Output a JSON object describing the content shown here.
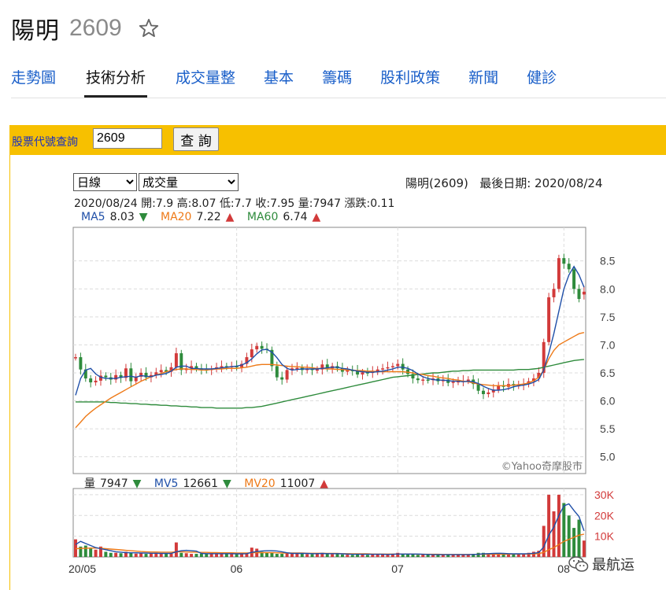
{
  "header": {
    "name": "陽明",
    "code": "2609"
  },
  "tabs": [
    "走勢圖",
    "技術分析",
    "成交量整",
    "基本",
    "籌碼",
    "股利政策",
    "新聞",
    "健診"
  ],
  "active_tab": 1,
  "query": {
    "label": "股票代號查詢",
    "value": "2609",
    "button": "查 詢"
  },
  "controls": {
    "period": "日線",
    "indicator": "成交量"
  },
  "info": {
    "title": "陽明(2609)",
    "last_date_label": "最後日期:",
    "last_date": "2020/08/24"
  },
  "ohlc": {
    "date": "2020/08/24",
    "open_label": "開:",
    "open": "7.9",
    "high_label": "高:",
    "high": "8.07",
    "low_label": "低:",
    "low": "7.7",
    "close_label": "收:",
    "close": "7.95",
    "volume_label": "量:",
    "volume": "7947",
    "change_label": "漲跌:",
    "change": "0.11"
  },
  "ma": [
    {
      "label": "MA5",
      "value": "8.03",
      "dir": "down",
      "color": "#1f4fa8"
    },
    {
      "label": "MA20",
      "value": "7.22",
      "dir": "up",
      "color": "#ee7a18"
    },
    {
      "label": "MA60",
      "value": "6.74",
      "dir": "up",
      "color": "#2e8b3c"
    }
  ],
  "volume_legend": [
    {
      "label": "量",
      "value": "7947",
      "dir": "down",
      "color": "#222222"
    },
    {
      "label": "MV5",
      "value": "12661",
      "dir": "down",
      "color": "#1f4fa8"
    },
    {
      "label": "MV20",
      "value": "11007",
      "dir": "up",
      "color": "#ee7a18"
    }
  ],
  "watermark": "©Yahoo奇摩股市",
  "logo_text": "最航运",
  "colors": {
    "up": "#d23a3a",
    "down": "#2e8b3c",
    "ma5": "#1f4fa8",
    "ma20": "#ee7a18",
    "ma60": "#2e8b3c",
    "accent": "#f7c000",
    "link": "#1a5fc9"
  },
  "chart_data": {
    "type": "candlestick",
    "y_ticks": [
      "8.5",
      "8.0",
      "7.5",
      "7.0",
      "6.5",
      "6.0",
      "5.5",
      "5.0"
    ],
    "ylim": [
      4.7,
      9.1
    ],
    "vol_ticks": [
      "30K",
      "20K",
      "10K"
    ],
    "vol_max": 33000,
    "x_labels": [
      "20/05",
      "06",
      "07",
      "08"
    ],
    "x_label_index": [
      0,
      32,
      64,
      97
    ],
    "closes": [
      6.78,
      6.56,
      6.4,
      6.33,
      6.36,
      6.45,
      6.42,
      6.38,
      6.46,
      6.41,
      6.58,
      6.35,
      6.43,
      6.5,
      6.42,
      6.46,
      6.51,
      6.55,
      6.52,
      6.6,
      6.85,
      6.55,
      6.58,
      6.62,
      6.58,
      6.56,
      6.55,
      6.57,
      6.6,
      6.62,
      6.61,
      6.62,
      6.6,
      6.66,
      6.78,
      6.92,
      6.98,
      6.93,
      6.91,
      6.62,
      6.42,
      6.38,
      6.55,
      6.58,
      6.59,
      6.55,
      6.57,
      6.55,
      6.56,
      6.65,
      6.58,
      6.62,
      6.58,
      6.52,
      6.55,
      6.54,
      6.47,
      6.51,
      6.5,
      6.52,
      6.56,
      6.58,
      6.6,
      6.62,
      6.66,
      6.56,
      6.48,
      6.4,
      6.37,
      6.38,
      6.37,
      6.4,
      6.35,
      6.38,
      6.32,
      6.34,
      6.35,
      6.36,
      6.38,
      6.3,
      6.18,
      6.12,
      6.15,
      6.2,
      6.28,
      6.25,
      6.3,
      6.27,
      6.28,
      6.3,
      6.35,
      6.4,
      6.5,
      7.05,
      7.85,
      8.0,
      8.55,
      8.45,
      8.35,
      8.0,
      7.82,
      7.95
    ],
    "volumes": [
      8.5,
      5.0,
      5.5,
      4.0,
      3.5,
      5.0,
      2.5,
      2.0,
      2.0,
      1.8,
      2.5,
      2.0,
      1.6,
      1.8,
      1.5,
      1.8,
      2.0,
      1.5,
      1.8,
      1.6,
      7.0,
      2.0,
      1.8,
      1.5,
      1.5,
      1.6,
      1.4,
      1.8,
      1.5,
      1.6,
      1.5,
      1.6,
      1.3,
      1.5,
      2.0,
      4.5,
      4.0,
      2.5,
      2.0,
      2.2,
      1.5,
      1.5,
      1.8,
      1.5,
      2.0,
      1.6,
      1.4,
      1.3,
      1.5,
      2.0,
      1.4,
      1.3,
      1.5,
      1.2,
      1.1,
      1.0,
      1.5,
      1.2,
      1.0,
      1.5,
      1.3,
      1.2,
      1.0,
      1.4,
      2.0,
      1.5,
      1.3,
      1.2,
      1.0,
      1.2,
      1.1,
      1.0,
      1.2,
      1.0,
      1.1,
      1.0,
      1.0,
      1.2,
      1.0,
      1.5,
      2.0,
      2.0,
      1.8,
      1.5,
      1.5,
      1.3,
      1.5,
      1.4,
      1.5,
      1.6,
      2.0,
      2.5,
      3.0,
      15.0,
      30.0,
      22.0,
      30.0,
      26.0,
      20.0,
      14.0,
      18.0,
      7.9
    ],
    "ma5": [
      6.1,
      6.4,
      6.55,
      6.58,
      6.48,
      6.42,
      6.4,
      6.4,
      6.4,
      6.42,
      6.43,
      6.44,
      6.42,
      6.45,
      6.44,
      6.43,
      6.46,
      6.47,
      6.49,
      6.53,
      6.6,
      6.62,
      6.62,
      6.58,
      6.58,
      6.57,
      6.57,
      6.57,
      6.58,
      6.59,
      6.6,
      6.61,
      6.62,
      6.64,
      6.68,
      6.75,
      6.84,
      6.91,
      6.92,
      6.87,
      6.77,
      6.65,
      6.58,
      6.55,
      6.56,
      6.57,
      6.57,
      6.57,
      6.57,
      6.58,
      6.59,
      6.6,
      6.6,
      6.58,
      6.57,
      6.55,
      6.53,
      6.52,
      6.51,
      6.51,
      6.52,
      6.53,
      6.55,
      6.57,
      6.6,
      6.6,
      6.58,
      6.54,
      6.48,
      6.43,
      6.4,
      6.38,
      6.37,
      6.37,
      6.36,
      6.35,
      6.35,
      6.34,
      6.35,
      6.34,
      6.31,
      6.26,
      6.22,
      6.19,
      6.19,
      6.2,
      6.22,
      6.25,
      6.27,
      6.28,
      6.3,
      6.33,
      6.38,
      6.55,
      6.85,
      7.2,
      7.6,
      8.0,
      8.25,
      8.4,
      8.25,
      8.03
    ],
    "ma20": [
      5.52,
      5.62,
      5.72,
      5.8,
      5.87,
      5.93,
      5.99,
      6.05,
      6.1,
      6.15,
      6.2,
      6.25,
      6.3,
      6.35,
      6.39,
      6.43,
      6.46,
      6.49,
      6.52,
      6.54,
      6.56,
      6.57,
      6.57,
      6.56,
      6.56,
      6.55,
      6.55,
      6.56,
      6.57,
      6.57,
      6.58,
      6.58,
      6.58,
      6.59,
      6.6,
      6.62,
      6.64,
      6.65,
      6.65,
      6.65,
      6.64,
      6.63,
      6.62,
      6.61,
      6.61,
      6.6,
      6.6,
      6.59,
      6.58,
      6.58,
      6.57,
      6.57,
      6.56,
      6.56,
      6.55,
      6.55,
      6.54,
      6.54,
      6.53,
      6.53,
      6.52,
      6.52,
      6.52,
      6.52,
      6.52,
      6.52,
      6.51,
      6.5,
      6.48,
      6.47,
      6.45,
      6.44,
      6.42,
      6.41,
      6.4,
      6.38,
      6.37,
      6.35,
      6.34,
      6.32,
      6.3,
      6.29,
      6.28,
      6.27,
      6.27,
      6.27,
      6.27,
      6.28,
      6.29,
      6.3,
      6.32,
      6.36,
      6.42,
      6.55,
      6.75,
      6.9,
      7.0,
      7.05,
      7.1,
      7.15,
      7.2,
      7.22
    ],
    "ma60": [
      5.98,
      5.98,
      5.98,
      5.98,
      5.98,
      5.98,
      5.98,
      5.97,
      5.97,
      5.96,
      5.96,
      5.95,
      5.95,
      5.94,
      5.94,
      5.93,
      5.93,
      5.92,
      5.92,
      5.91,
      5.91,
      5.9,
      5.9,
      5.89,
      5.89,
      5.88,
      5.88,
      5.88,
      5.87,
      5.87,
      5.87,
      5.87,
      5.87,
      5.87,
      5.88,
      5.88,
      5.89,
      5.9,
      5.92,
      5.94,
      5.96,
      5.98,
      6.0,
      6.02,
      6.04,
      6.06,
      6.08,
      6.1,
      6.12,
      6.14,
      6.16,
      6.18,
      6.2,
      6.22,
      6.24,
      6.26,
      6.28,
      6.3,
      6.32,
      6.34,
      6.36,
      6.38,
      6.4,
      6.42,
      6.43,
      6.44,
      6.45,
      6.46,
      6.47,
      6.48,
      6.49,
      6.5,
      6.5,
      6.51,
      6.52,
      6.53,
      6.53,
      6.54,
      6.54,
      6.55,
      6.55,
      6.55,
      6.55,
      6.55,
      6.55,
      6.55,
      6.55,
      6.55,
      6.56,
      6.56,
      6.56,
      6.57,
      6.58,
      6.6,
      6.62,
      6.64,
      6.66,
      6.68,
      6.7,
      6.72,
      6.73,
      6.74
    ],
    "mv5": [
      6.0,
      7.5,
      6.5,
      5.5,
      4.5,
      4.0,
      3.5,
      3.0,
      2.5,
      2.3,
      2.1,
      2.0,
      2.0,
      1.9,
      1.9,
      1.8,
      1.8,
      1.7,
      1.7,
      1.7,
      2.5,
      3.0,
      3.2,
      3.0,
      2.8,
      1.7,
      1.6,
      1.6,
      1.6,
      1.6,
      1.6,
      1.6,
      1.5,
      1.5,
      1.6,
      2.2,
      2.6,
      2.9,
      3.0,
      3.0,
      2.9,
      2.5,
      2.0,
      1.7,
      1.7,
      1.7,
      1.7,
      1.6,
      1.6,
      1.7,
      1.6,
      1.6,
      1.6,
      1.5,
      1.4,
      1.3,
      1.3,
      1.3,
      1.3,
      1.3,
      1.3,
      1.3,
      1.2,
      1.3,
      1.4,
      1.4,
      1.4,
      1.4,
      1.4,
      1.3,
      1.2,
      1.1,
      1.1,
      1.1,
      1.1,
      1.1,
      1.1,
      1.1,
      1.1,
      1.2,
      1.3,
      1.5,
      1.6,
      1.7,
      1.8,
      1.7,
      1.6,
      1.5,
      1.5,
      1.5,
      1.6,
      1.8,
      2.1,
      4.8,
      10.5,
      14.4,
      20.0,
      24.6,
      25.6,
      22.4,
      19.5,
      12.6
    ],
    "mv20": [
      4.0,
      4.1,
      4.2,
      4.3,
      4.3,
      4.2,
      4.0,
      3.8,
      3.6,
      3.4,
      3.2,
      3.0,
      2.8,
      2.6,
      2.5,
      2.4,
      2.4,
      2.3,
      2.3,
      2.3,
      2.5,
      2.5,
      2.4,
      2.3,
      2.3,
      2.2,
      2.2,
      2.1,
      2.1,
      2.0,
      2.0,
      2.0,
      1.9,
      1.9,
      1.9,
      2.0,
      2.1,
      2.1,
      2.1,
      2.1,
      2.0,
      1.9,
      1.9,
      1.9,
      1.9,
      1.9,
      1.8,
      1.8,
      1.8,
      1.8,
      1.7,
      1.7,
      1.7,
      1.6,
      1.6,
      1.5,
      1.5,
      1.5,
      1.5,
      1.4,
      1.4,
      1.4,
      1.4,
      1.4,
      1.4,
      1.4,
      1.4,
      1.4,
      1.3,
      1.3,
      1.3,
      1.3,
      1.3,
      1.2,
      1.2,
      1.2,
      1.2,
      1.2,
      1.2,
      1.2,
      1.3,
      1.3,
      1.3,
      1.3,
      1.3,
      1.3,
      1.3,
      1.4,
      1.4,
      1.4,
      1.4,
      1.5,
      1.6,
      2.2,
      3.5,
      4.5,
      6.0,
      7.5,
      8.5,
      9.5,
      10.5,
      11.0
    ]
  }
}
